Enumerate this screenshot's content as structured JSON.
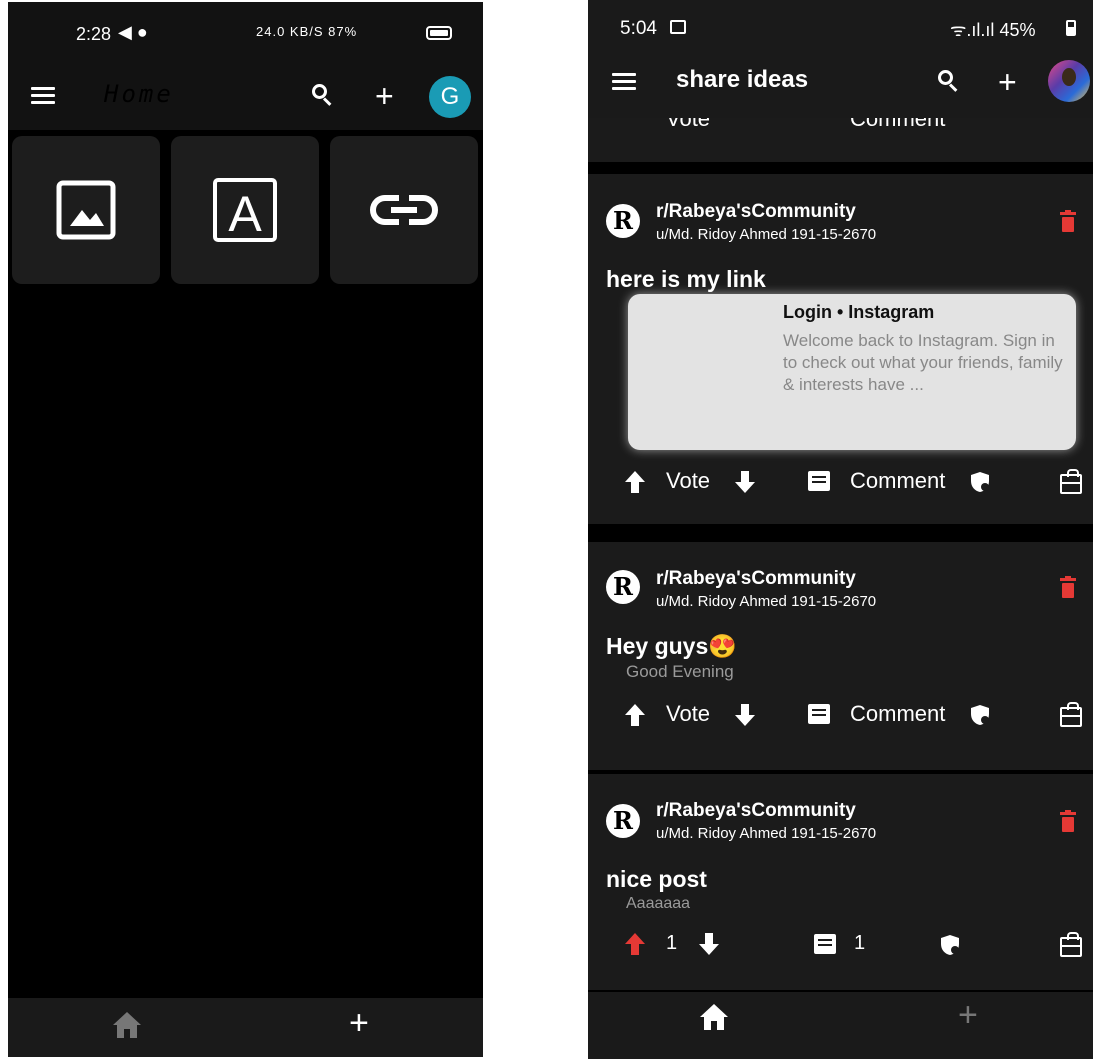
{
  "left": {
    "status": {
      "time": "2:28",
      "right": "24.0 KB/S  87%"
    },
    "appbar": {
      "title": "Home",
      "avatar_letter": "G",
      "avatar_color": "#1a9bb5"
    },
    "tiles": [
      {
        "icon": "image-icon"
      },
      {
        "icon": "text-icon",
        "glyph": "A"
      },
      {
        "icon": "link-icon"
      }
    ],
    "bottom_nav": {
      "add_label": "+"
    }
  },
  "right": {
    "status": {
      "time": "5:04",
      "battery": "45%"
    },
    "appbar": {
      "title": "share ideas"
    },
    "partial_card": {
      "vote_label": "Vote",
      "comment_label": "Comment"
    },
    "posts": [
      {
        "community_initial": "R",
        "community": "r/Rabeya'sCommunity",
        "author": "u/Md. Ridoy Ahmed 191-15-2670",
        "title": "here is my link",
        "link_preview": {
          "title": "Login • Instagram",
          "description": "Welcome back to Instagram. Sign in to check out what your friends, family & interests have ..."
        },
        "vote_label": "Vote",
        "comment_label": "Comment"
      },
      {
        "community_initial": "R",
        "community": "r/Rabeya'sCommunity",
        "author": "u/Md. Ridoy Ahmed 191-15-2670",
        "title": "Hey guys😍",
        "subtitle": "Good Evening",
        "vote_label": "Vote",
        "comment_label": "Comment"
      },
      {
        "community_initial": "R",
        "community": "r/Rabeya'sCommunity",
        "author": "u/Md. Ridoy Ahmed 191-15-2670",
        "title": "nice post",
        "subtitle": "Aaaaaaa",
        "vote_count": "1",
        "comment_count": "1",
        "upvote_color": "#e53935"
      }
    ],
    "colors": {
      "delete": "#e53935",
      "card_bg": "#1b1b1b"
    }
  }
}
